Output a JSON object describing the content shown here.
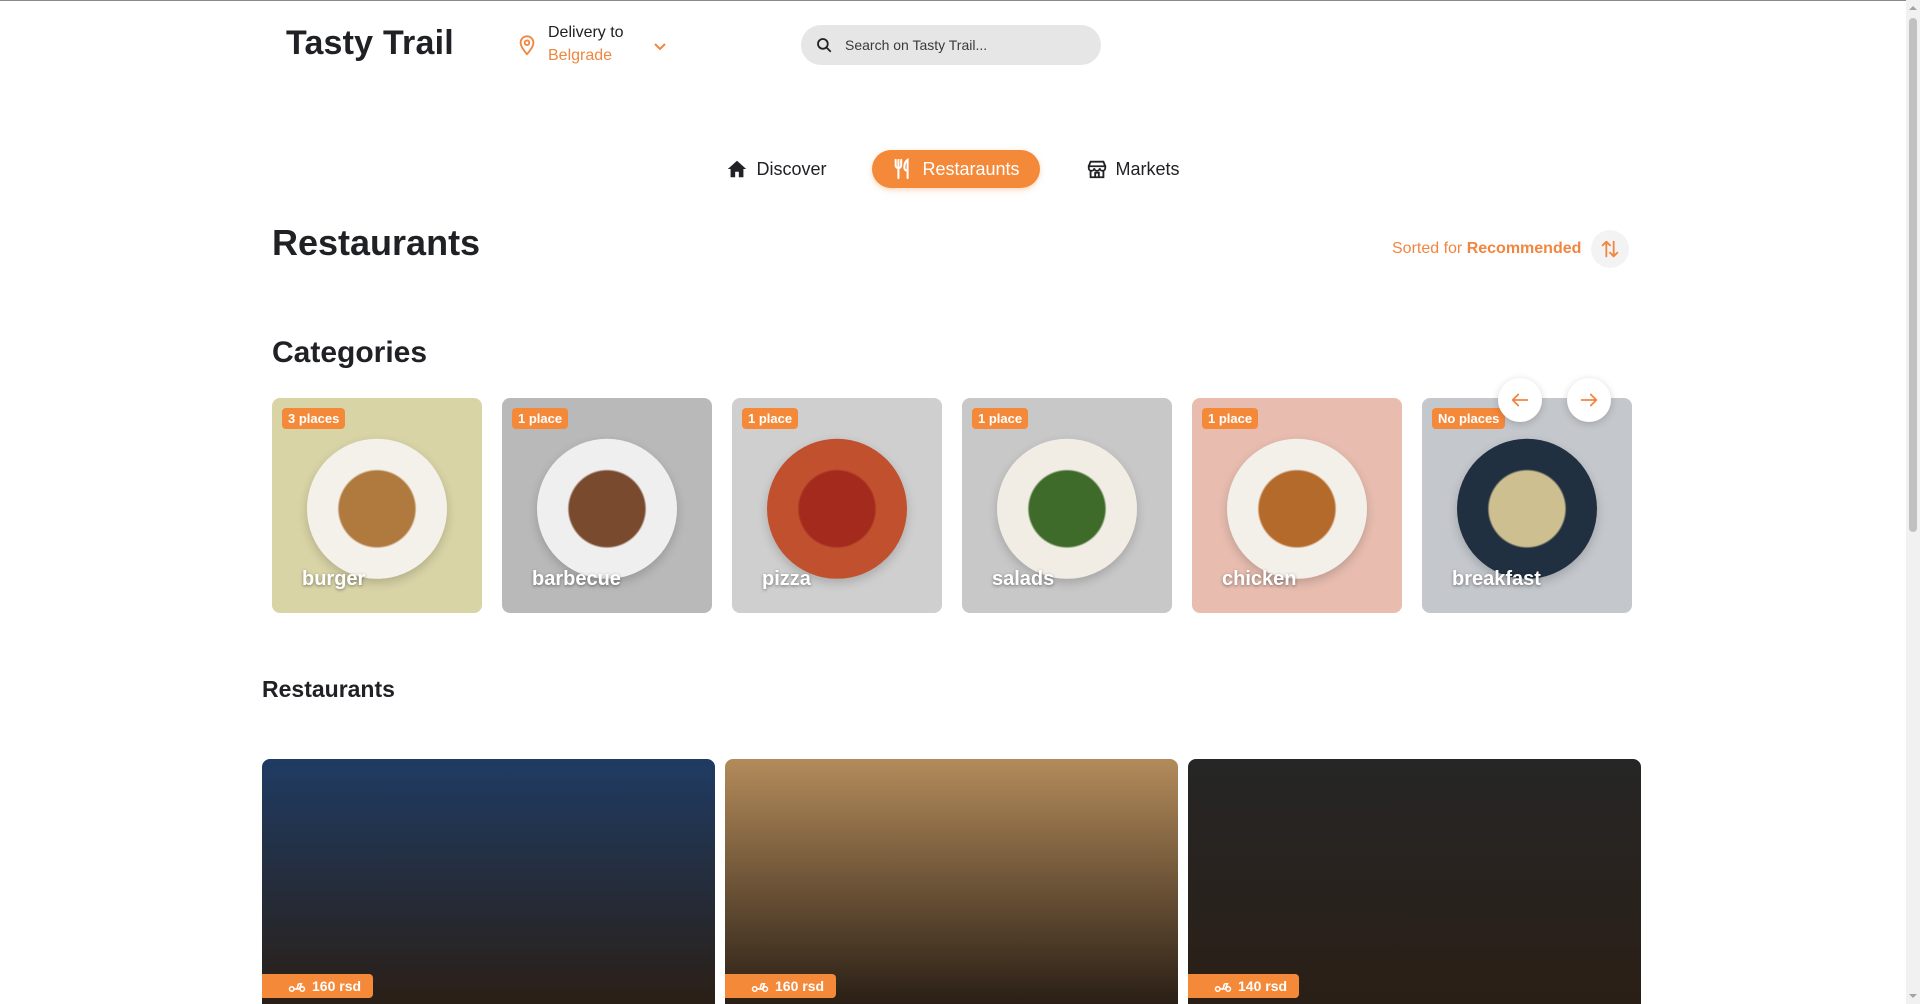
{
  "header": {
    "logo": "Tasty Trail",
    "delivery_label": "Delivery to",
    "delivery_city": "Belgrade",
    "search_placeholder": "Search on Tasty Trail..."
  },
  "nav": {
    "tabs": [
      {
        "label": "Discover",
        "icon": "home-icon",
        "active": false
      },
      {
        "label": "Restaraunts",
        "icon": "fork-knife-icon",
        "active": true
      },
      {
        "label": "Markets",
        "icon": "store-icon",
        "active": false
      }
    ]
  },
  "page": {
    "title": "Restaurants",
    "sort_prefix": "Sorted for ",
    "sort_value": "Recommended",
    "categories_title": "Categories",
    "restaurants_title": "Restaurants"
  },
  "categories": [
    {
      "name": "burger",
      "badge": "3 places",
      "bg": "#d9d4a6",
      "plate": "#f4f1ea",
      "food": "#b07a3e"
    },
    {
      "name": "barbecue",
      "badge": "1 place",
      "bg": "#b9b9b9",
      "plate": "#efefef",
      "food": "#7a4a2e"
    },
    {
      "name": "pizza",
      "badge": "1 place",
      "bg": "#cfcfcf",
      "plate": "#c0502e",
      "food": "#a52a1e"
    },
    {
      "name": "salads",
      "badge": "1 place",
      "bg": "#c8c8c8",
      "plate": "#f1ede5",
      "food": "#3f6b2a"
    },
    {
      "name": "chicken",
      "badge": "1 place",
      "bg": "#e8bdb0",
      "plate": "#f3efe9",
      "food": "#b46a2a"
    },
    {
      "name": "breakfast",
      "badge": "No places",
      "bg": "#c4c7cc",
      "plate": "#203040",
      "food": "#cdbf8f"
    }
  ],
  "restaurants": [
    {
      "fee": "160 rsd",
      "bg": "#1f3b63"
    },
    {
      "fee": "160 rsd",
      "bg": "#b38b5a"
    },
    {
      "fee": "140 rsd",
      "bg": "#262626"
    }
  ],
  "colors": {
    "accent": "#f5893a",
    "accent_text": "#f0863f"
  }
}
